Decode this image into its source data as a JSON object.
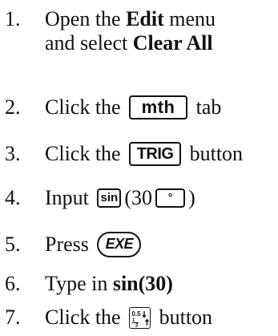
{
  "steps": [
    {
      "num": "1.",
      "line1_a": "Open the ",
      "edit": "Edit",
      "line1_b": " menu",
      "line2_a": "and select ",
      "clear_all": "Clear All"
    },
    {
      "num": "2.",
      "before": "Click the ",
      "key": "mth",
      "after": " tab"
    },
    {
      "num": "3.",
      "before": "Click the ",
      "key": "TRIG",
      "after": " button"
    },
    {
      "num": "4.",
      "before": "Input ",
      "key_sin": "sin",
      "paren_open": "(30",
      "key_deg": "°",
      "paren_close": ")"
    },
    {
      "num": "5.",
      "before": "Press ",
      "key": "EXE"
    },
    {
      "num": "6.",
      "before": "Type in ",
      "bold": "sin(30)"
    },
    {
      "num": "7.",
      "before": "Click the ",
      "key_icon": "fraction-decimal-toggle-icon",
      "after": " button"
    }
  ]
}
